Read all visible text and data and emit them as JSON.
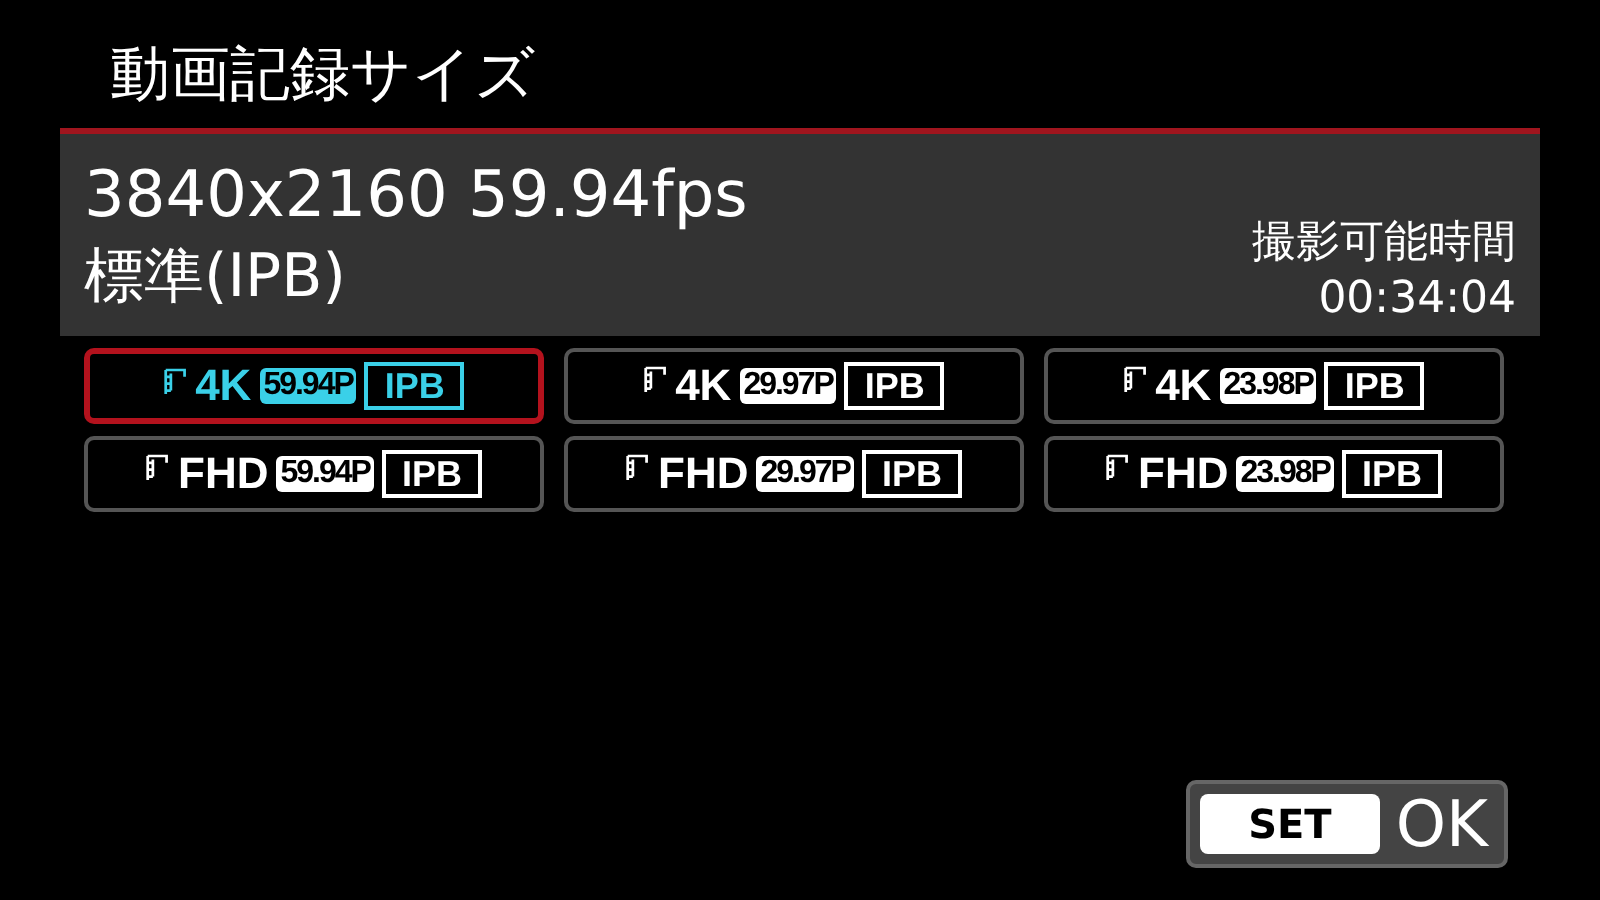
{
  "title": "動画記録サイズ",
  "info": {
    "resolution": "3840x2160 59.94fps",
    "compression": "標準(IPB)",
    "remaining_label": "撮影可能時間",
    "remaining_time": "00:34:04"
  },
  "options": [
    {
      "size": "4K",
      "rate": "59.94P",
      "codec": "IPB",
      "selected": true
    },
    {
      "size": "4K",
      "rate": "29.97P",
      "codec": "IPB",
      "selected": false
    },
    {
      "size": "4K",
      "rate": "23.98P",
      "codec": "IPB",
      "selected": false
    },
    {
      "size": "FHD",
      "rate": "59.94P",
      "codec": "IPB",
      "selected": false
    },
    {
      "size": "FHD",
      "rate": "29.97P",
      "codec": "IPB",
      "selected": false
    },
    {
      "size": "FHD",
      "rate": "23.98P",
      "codec": "IPB",
      "selected": false
    }
  ],
  "set_button": {
    "key": "SET",
    "label": "OK"
  }
}
